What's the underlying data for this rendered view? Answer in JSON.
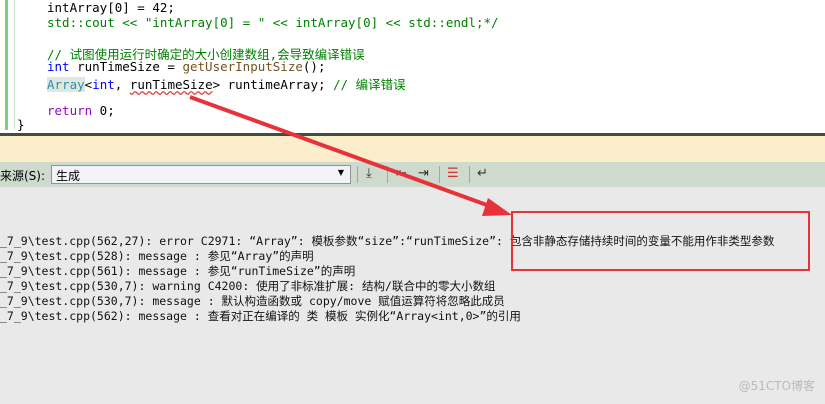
{
  "code": {
    "line1": "intArray[0] = 42;",
    "line2": "std::cout << \"intArray[0] = \" << intArray[0] << std::endl;*/",
    "comment": "// 试图使用运行时确定的大小创建数组,会导致编译错误",
    "l4_kw": "int",
    "l4_rest": " runTimeSize = ",
    "l4_fn": "getUserInputSize",
    "l4_end": "();",
    "l5_type": "Array",
    "l5_a": "<",
    "l5_kw": "int",
    "l5_b": ", ",
    "l5_sq": "runTimeSize",
    "l5_c": "> runtimeArray; ",
    "l5_cm": "// 编译错误",
    "l7_kw": "return",
    "l7_rest": " 0;",
    "brace": "}"
  },
  "toolbar": {
    "source_label": "来源(S):",
    "source_value": "生成"
  },
  "output": [
    "_7_9\\test.cpp(562,27): error C2971: “Array”: 模板参数“size”:“runTimeSize”: 包含非静态存储持续时间的变量不能用作非类型参数",
    "_7_9\\test.cpp(528): message : 参见“Array”的声明",
    "_7_9\\test.cpp(561): message : 参见“runTimeSize”的声明",
    "_7_9\\test.cpp(530,7): warning C4200: 使用了非标准扩展: 结构/联合中的零大小数组",
    "_7_9\\test.cpp(530,7): message : 默认构造函数或 copy/move 赋值运算符将忽略此成员",
    "_7_9\\test.cpp(562): message : 查看对正在编译的 类 模板 实例化“Array<int,0>”的引用"
  ],
  "watermark": "@51CTO博客",
  "colors": {
    "annotation": "#e6333a"
  }
}
